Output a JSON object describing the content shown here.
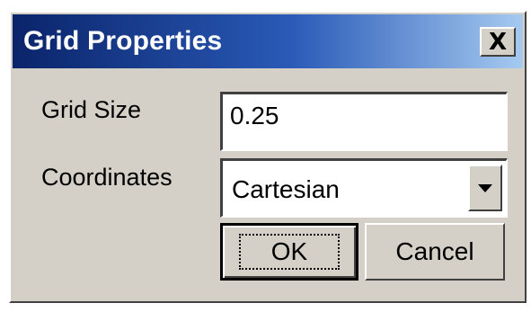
{
  "window": {
    "title": "Grid Properties",
    "close_icon": "close-icon",
    "close_glyph": "X"
  },
  "form": {
    "grid_size_label": "Grid Size",
    "grid_size_value": "0.25",
    "coordinates_label": "Coordinates",
    "coordinates_value": "Cartesian",
    "dropdown_icon": "chevron-down-icon"
  },
  "buttons": {
    "ok_label": "OK",
    "cancel_label": "Cancel"
  },
  "colors": {
    "title_bar_start": "#0a246a",
    "title_bar_end": "#a6caf0",
    "face": "#d4d0c8"
  }
}
